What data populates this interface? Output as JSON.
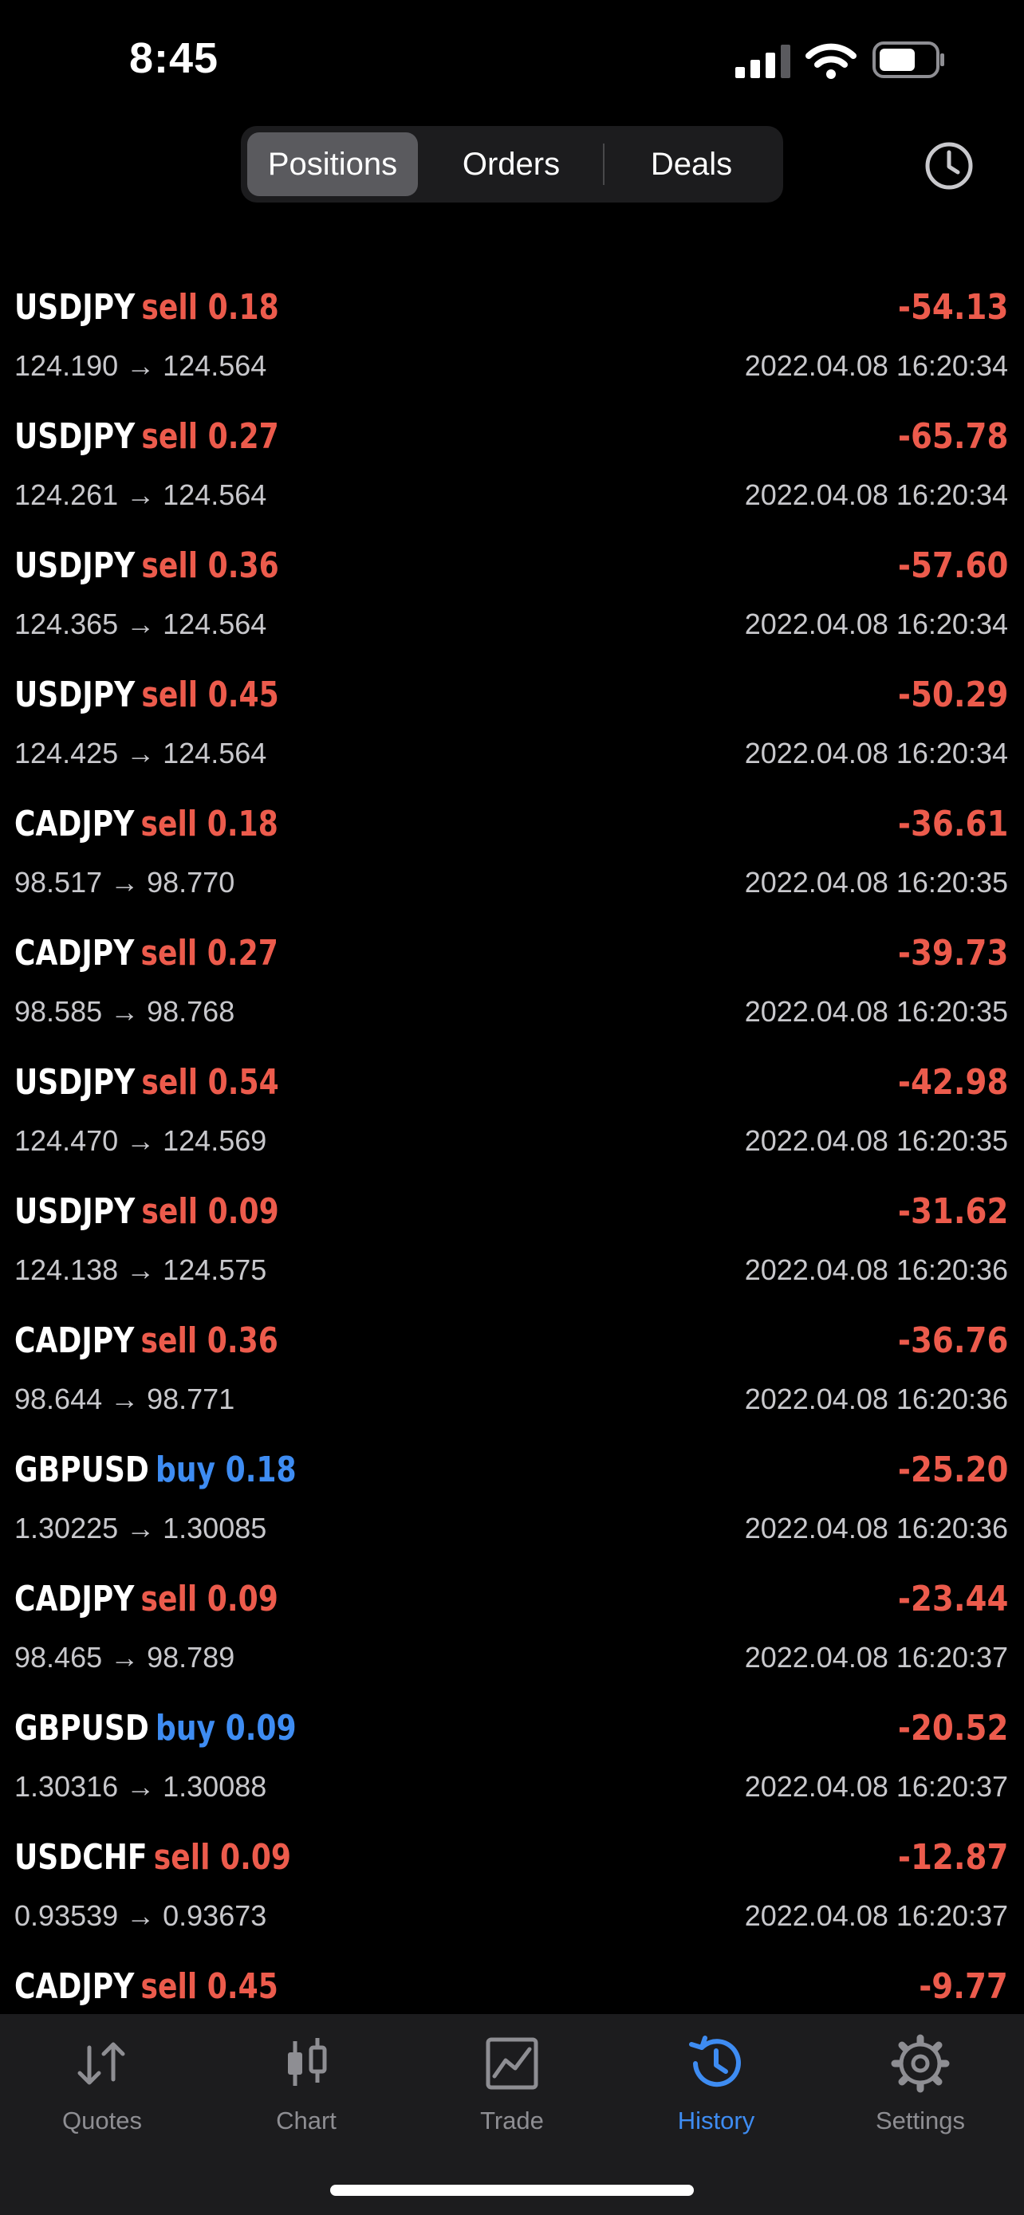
{
  "status_bar": {
    "time": "8:45"
  },
  "segmented": {
    "tabs": [
      {
        "label": "Positions",
        "active": true
      },
      {
        "label": "Orders",
        "active": false
      },
      {
        "label": "Deals",
        "active": false
      }
    ]
  },
  "list": {
    "rows": [
      {
        "symbol": "USDJPY",
        "side": "sell",
        "volume": "0.18",
        "prices": "124.190 → 124.564",
        "profit": "-54.13",
        "time": "2022.04.08 16:20:34"
      },
      {
        "symbol": "USDJPY",
        "side": "sell",
        "volume": "0.27",
        "prices": "124.261 → 124.564",
        "profit": "-65.78",
        "time": "2022.04.08 16:20:34"
      },
      {
        "symbol": "USDJPY",
        "side": "sell",
        "volume": "0.36",
        "prices": "124.365 → 124.564",
        "profit": "-57.60",
        "time": "2022.04.08 16:20:34"
      },
      {
        "symbol": "USDJPY",
        "side": "sell",
        "volume": "0.45",
        "prices": "124.425 → 124.564",
        "profit": "-50.29",
        "time": "2022.04.08 16:20:34"
      },
      {
        "symbol": "CADJPY",
        "side": "sell",
        "volume": "0.18",
        "prices": "98.517 → 98.770",
        "profit": "-36.61",
        "time": "2022.04.08 16:20:35"
      },
      {
        "symbol": "CADJPY",
        "side": "sell",
        "volume": "0.27",
        "prices": "98.585 → 98.768",
        "profit": "-39.73",
        "time": "2022.04.08 16:20:35"
      },
      {
        "symbol": "USDJPY",
        "side": "sell",
        "volume": "0.54",
        "prices": "124.470 → 124.569",
        "profit": "-42.98",
        "time": "2022.04.08 16:20:35"
      },
      {
        "symbol": "USDJPY",
        "side": "sell",
        "volume": "0.09",
        "prices": "124.138 → 124.575",
        "profit": "-31.62",
        "time": "2022.04.08 16:20:36"
      },
      {
        "symbol": "CADJPY",
        "side": "sell",
        "volume": "0.36",
        "prices": "98.644 → 98.771",
        "profit": "-36.76",
        "time": "2022.04.08 16:20:36"
      },
      {
        "symbol": "GBPUSD",
        "side": "buy",
        "volume": "0.18",
        "prices": "1.30225 → 1.30085",
        "profit": "-25.20",
        "time": "2022.04.08 16:20:36"
      },
      {
        "symbol": "CADJPY",
        "side": "sell",
        "volume": "0.09",
        "prices": "98.465 → 98.789",
        "profit": "-23.44",
        "time": "2022.04.08 16:20:37"
      },
      {
        "symbol": "GBPUSD",
        "side": "buy",
        "volume": "0.09",
        "prices": "1.30316 → 1.30088",
        "profit": "-20.52",
        "time": "2022.04.08 16:20:37"
      },
      {
        "symbol": "USDCHF",
        "side": "sell",
        "volume": "0.09",
        "prices": "0.93539 → 0.93673",
        "profit": "-12.87",
        "time": "2022.04.08 16:20:37"
      },
      {
        "symbol": "CADJPY",
        "side": "sell",
        "volume": "0.45",
        "prices": "",
        "profit": "-9.77",
        "time": ""
      }
    ]
  },
  "tab_bar": {
    "tabs": [
      {
        "label": "Quotes",
        "icon": "quotes-arrows-icon",
        "active": false
      },
      {
        "label": "Chart",
        "icon": "candlestick-icon",
        "active": false
      },
      {
        "label": "Trade",
        "icon": "trade-chart-icon",
        "active": false
      },
      {
        "label": "History",
        "icon": "history-clock-icon",
        "active": true
      },
      {
        "label": "Settings",
        "icon": "gear-icon",
        "active": false
      }
    ]
  },
  "colors": {
    "sell": "#ec5b4c",
    "buy": "#3e8cf2",
    "active_tab": "#3e8cf2",
    "inactive_tab": "#8e8e93"
  }
}
